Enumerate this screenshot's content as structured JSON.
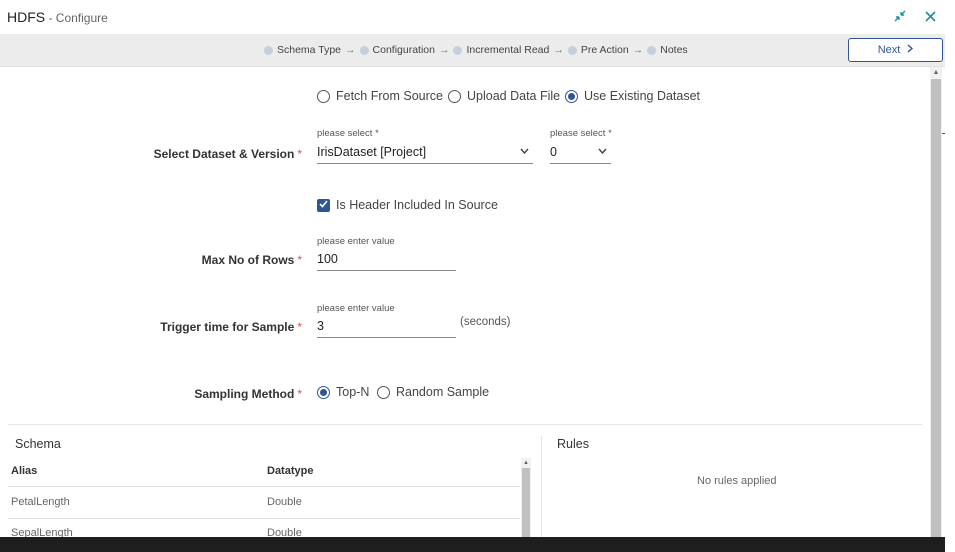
{
  "window": {
    "title": "HDFS",
    "subtitle": " - Configure",
    "minimize_icon": "collapse-arrows-icon",
    "close_icon": "close-icon",
    "accent_color": "#1f8ea3"
  },
  "steps": [
    {
      "label": "Schema Type"
    },
    {
      "label": "Configuration"
    },
    {
      "label": "Incremental Read"
    },
    {
      "label": "Pre Action"
    },
    {
      "label": "Notes"
    }
  ],
  "step_arrow": "→",
  "next_button": {
    "label": "Next",
    "icon": "chevron-right-icon",
    "color": "#2f5597"
  },
  "source_options": [
    {
      "label": "Fetch From Source",
      "selected": false
    },
    {
      "label": "Upload Data File",
      "selected": false
    },
    {
      "label": "Use Existing Dataset",
      "selected": true
    }
  ],
  "dataset": {
    "label": "Select Dataset & Version",
    "required_mark": "*",
    "dataset_hint": "please select *",
    "dataset_value": "IrisDataset [Project]",
    "version_hint": "please select *",
    "version_value": "0"
  },
  "header_checkbox": {
    "label": "Is Header Included In Source",
    "checked": true
  },
  "max_rows": {
    "label": "Max No of Rows",
    "required_mark": "*",
    "hint": "please enter value",
    "value": "100"
  },
  "trigger_time": {
    "label": "Trigger time for Sample",
    "required_mark": "*",
    "hint": "please enter value",
    "value": "3",
    "unit": "(seconds)"
  },
  "sampling": {
    "label": "Sampling Method",
    "required_mark": "*",
    "options": [
      {
        "label": "Top-N",
        "selected": true
      },
      {
        "label": "Random Sample",
        "selected": false
      }
    ]
  },
  "schema": {
    "title": "Schema",
    "columns": [
      "Alias",
      "Datatype"
    ],
    "rows": [
      [
        "PetalLength",
        "Double"
      ],
      [
        "SepalLength",
        "Double"
      ]
    ]
  },
  "rules": {
    "title": "Rules",
    "empty_text": "No rules applied"
  }
}
